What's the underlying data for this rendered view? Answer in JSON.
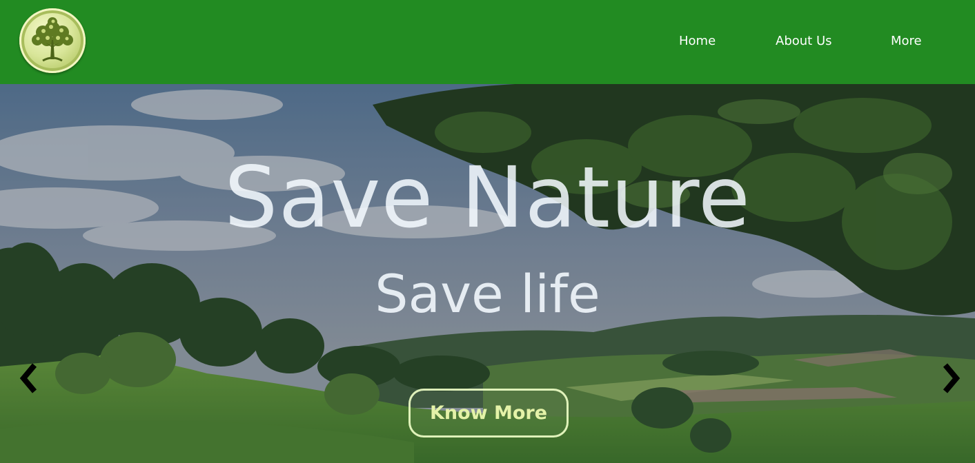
{
  "navbar": {
    "logo_icon": "tree-logo-icon",
    "links": [
      "Home",
      "About Us",
      "More"
    ],
    "background": "#228b22"
  },
  "hero": {
    "headline": "Save Nature",
    "subheadline": "Save life",
    "cta_label": "Know More",
    "prev_icon": "chevron-left-icon",
    "next_icon": "chevron-right-icon"
  }
}
